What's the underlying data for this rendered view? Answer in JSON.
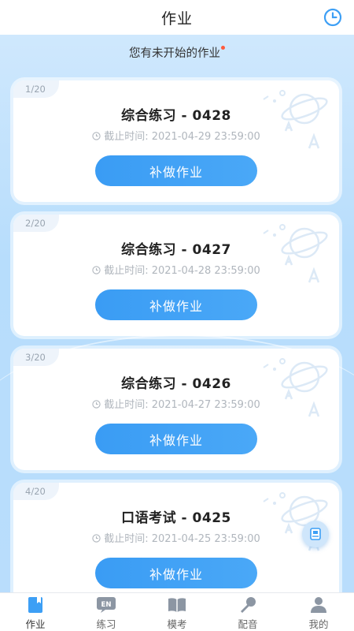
{
  "header": {
    "title": "作业"
  },
  "notice": {
    "text": "您有未开始的作业"
  },
  "cards": [
    {
      "index": "1/20",
      "title": "综合练习 - 0428",
      "deadline": "截止时间: 2021-04-29 23:59:00",
      "button": "补做作业"
    },
    {
      "index": "2/20",
      "title": "综合练习 - 0427",
      "deadline": "截止时间: 2021-04-28 23:59:00",
      "button": "补做作业"
    },
    {
      "index": "3/20",
      "title": "综合练习 - 0426",
      "deadline": "截止时间: 2021-04-27 23:59:00",
      "button": "补做作业"
    },
    {
      "index": "4/20",
      "title": "口语考试 - 0425",
      "deadline": "截止时间: 2021-04-25 23:59:00",
      "button": "补做作业"
    }
  ],
  "tabs": [
    {
      "label": "作业",
      "icon": "homework-icon",
      "active": true
    },
    {
      "label": "练习",
      "icon": "en-practice-icon",
      "active": false
    },
    {
      "label": "模考",
      "icon": "book-icon",
      "active": false
    },
    {
      "label": "配音",
      "icon": "microphone-icon",
      "active": false
    },
    {
      "label": "我的",
      "icon": "user-icon",
      "active": false
    }
  ],
  "colors": {
    "accent": "#3d9ff5",
    "background": "#c3e2fc",
    "notice_dot": "#ff5a3c"
  }
}
